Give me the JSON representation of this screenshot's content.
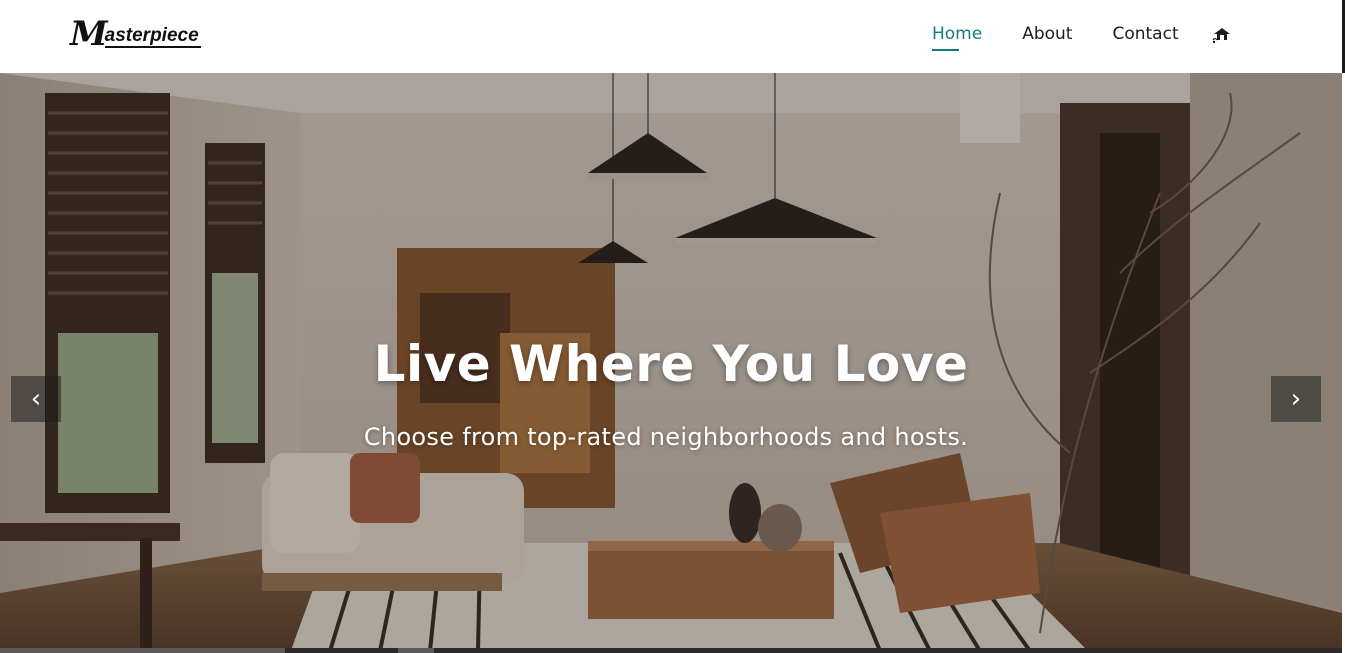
{
  "brand": {
    "logo_initial": "M",
    "logo_rest": "asterpiece"
  },
  "nav": {
    "items": [
      {
        "label": "Home",
        "active": true
      },
      {
        "label": "About",
        "active": false
      },
      {
        "label": "Contact",
        "active": false
      }
    ],
    "icon": "house-cap-icon"
  },
  "hero": {
    "title": "Live Where You Love",
    "subtitle": "Choose from top-rated neighborhoods and hosts.",
    "prev_arrow": "‹",
    "next_arrow": "›"
  },
  "colors": {
    "accent": "#137c7c",
    "nav_text": "#1c1c1c",
    "header_bg": "#ffffff"
  }
}
